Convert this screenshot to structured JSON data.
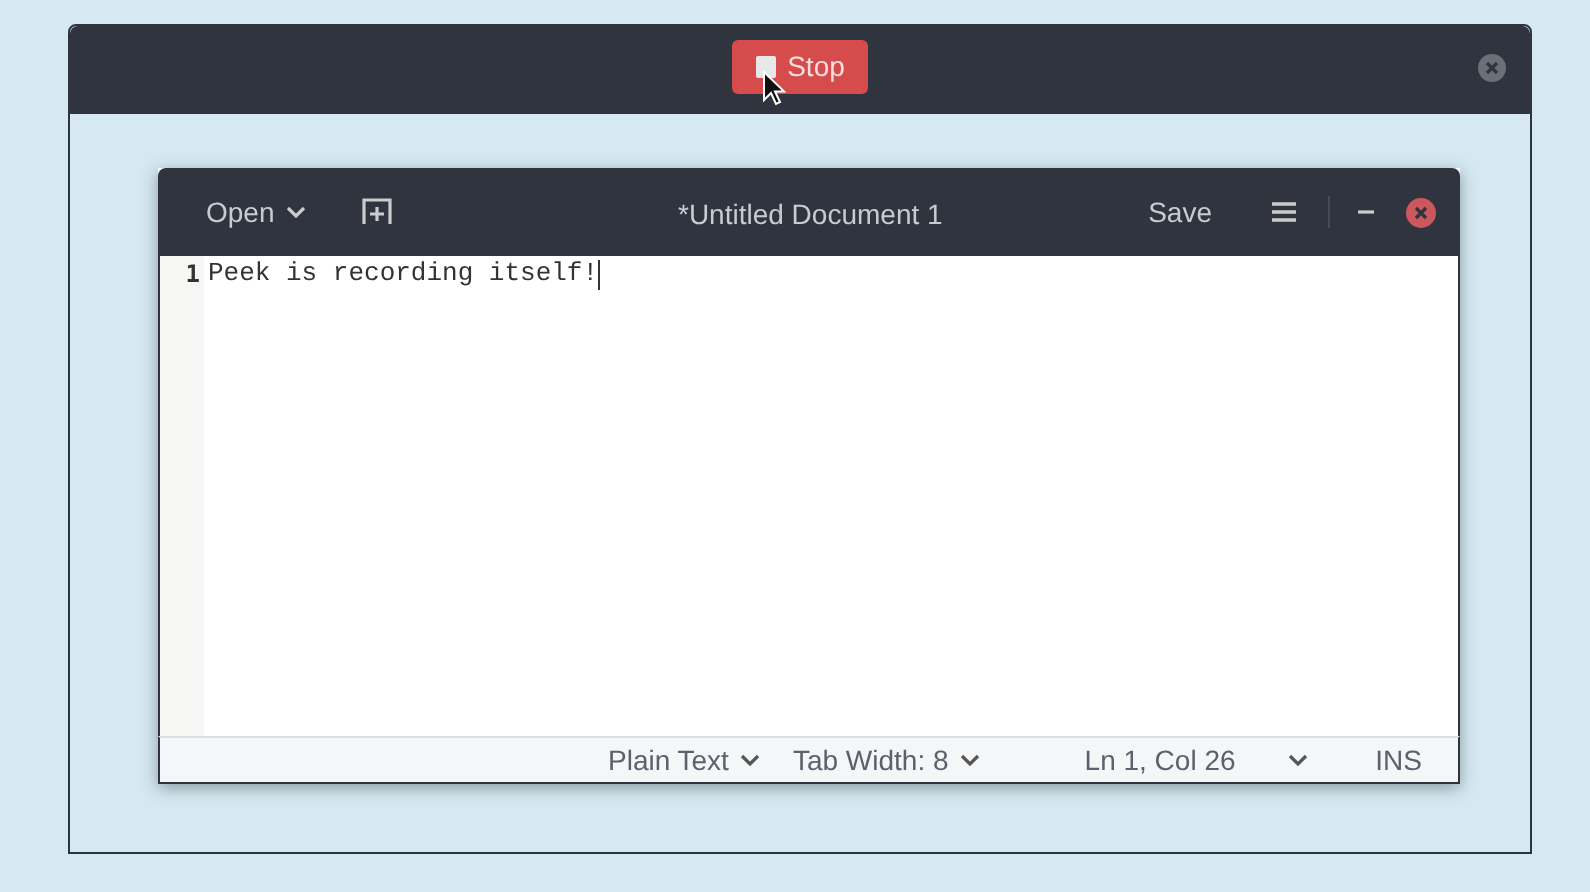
{
  "recorder": {
    "stop_button": "Stop"
  },
  "editor": {
    "header": {
      "open_button": "Open",
      "title": "*Untitled Document 1",
      "save_button": "Save"
    },
    "lines": [
      {
        "number": "1",
        "text": "Peek is recording itself!"
      }
    ],
    "status_bar": {
      "language": "Plain Text",
      "tab_width": "Tab Width: 8",
      "position": "Ln 1, Col 26",
      "mode": "INS"
    }
  }
}
